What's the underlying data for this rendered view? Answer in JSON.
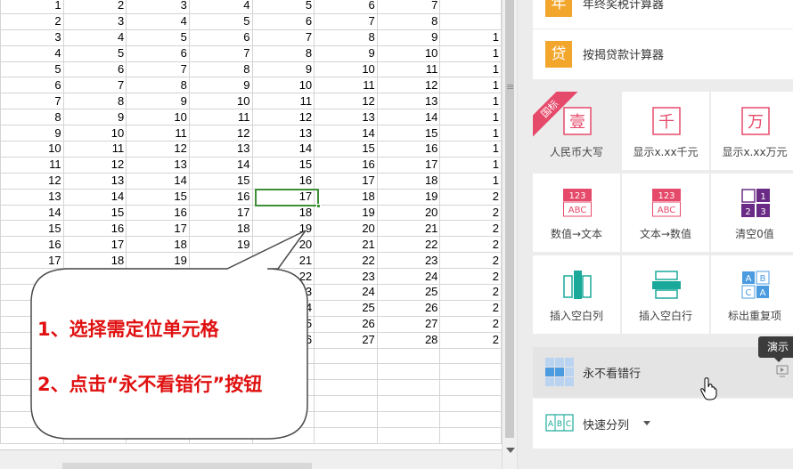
{
  "spreadsheet": {
    "rows": [
      [
        "1",
        "2",
        "3",
        "4",
        "5",
        "6",
        "7",
        ""
      ],
      [
        "2",
        "3",
        "4",
        "5",
        "6",
        "7",
        "8",
        ""
      ],
      [
        "3",
        "4",
        "5",
        "6",
        "7",
        "8",
        "9",
        "1"
      ],
      [
        "4",
        "5",
        "6",
        "7",
        "8",
        "9",
        "10",
        "1"
      ],
      [
        "5",
        "6",
        "7",
        "8",
        "9",
        "10",
        "11",
        "1"
      ],
      [
        "6",
        "7",
        "8",
        "9",
        "10",
        "11",
        "12",
        "1"
      ],
      [
        "7",
        "8",
        "9",
        "10",
        "11",
        "12",
        "13",
        "1"
      ],
      [
        "8",
        "9",
        "10",
        "11",
        "12",
        "13",
        "14",
        "1"
      ],
      [
        "9",
        "10",
        "11",
        "12",
        "13",
        "14",
        "15",
        "1"
      ],
      [
        "10",
        "11",
        "12",
        "13",
        "14",
        "15",
        "16",
        "1"
      ],
      [
        "11",
        "12",
        "13",
        "14",
        "15",
        "16",
        "17",
        "1"
      ],
      [
        "12",
        "13",
        "14",
        "15",
        "16",
        "17",
        "18",
        "1"
      ],
      [
        "13",
        "14",
        "15",
        "16",
        "17",
        "18",
        "19",
        "2"
      ],
      [
        "14",
        "15",
        "16",
        "17",
        "18",
        "19",
        "20",
        "2"
      ],
      [
        "15",
        "16",
        "17",
        "18",
        "19",
        "20",
        "21",
        "2"
      ],
      [
        "16",
        "17",
        "18",
        "19",
        "20",
        "21",
        "22",
        "2"
      ],
      [
        "17",
        "18",
        "19",
        "",
        "21",
        "22",
        "23",
        "2"
      ],
      [
        "",
        "",
        "",
        "",
        "22",
        "23",
        "24",
        "2"
      ],
      [
        "",
        "",
        "",
        "",
        "23",
        "24",
        "25",
        "2"
      ],
      [
        "",
        "",
        "",
        "",
        "24",
        "25",
        "26",
        "2"
      ],
      [
        "",
        "",
        "",
        "",
        "25",
        "26",
        "27",
        "2"
      ],
      [
        "",
        "",
        "",
        "",
        "26",
        "27",
        "28",
        "2"
      ],
      [
        "",
        "",
        "",
        "",
        "",
        "",
        "",
        ""
      ],
      [
        "",
        "",
        "",
        "",
        "",
        "",
        "",
        ""
      ],
      [
        "",
        "",
        "",
        "",
        "",
        "",
        "",
        ""
      ],
      [
        "",
        "",
        "",
        "",
        "",
        "",
        "",
        ""
      ],
      [
        "",
        "",
        "",
        "",
        "",
        "",
        "",
        ""
      ],
      [
        "",
        "",
        "",
        "",
        "",
        "",
        "",
        ""
      ]
    ]
  },
  "callout": {
    "line1": "1、选择需定位单元格",
    "line2": "2、点击“永不看错行”按钮"
  },
  "panel": {
    "top_items": [
      {
        "icon": "年",
        "label": "年终奖税计算器"
      },
      {
        "icon": "贷",
        "label": "按揭贷款计算器"
      }
    ],
    "ribbon": "国标",
    "tiles": [
      {
        "label": "人民币大写",
        "icon": "壹",
        "icon_name": "rmb-uppercase-icon"
      },
      {
        "label": "显示x.xx千元",
        "icon": "千",
        "icon_name": "thousand-icon"
      },
      {
        "label": "显示x.xx万元",
        "icon": "万",
        "icon_name": "ten-thousand-icon"
      },
      {
        "label": "数值→文本",
        "icon_top": "123",
        "icon_bottom": "ABC",
        "icon_name": "number-to-text-icon"
      },
      {
        "label": "文本→数值",
        "icon_top": "123",
        "icon_bottom": "ABC",
        "icon_name": "text-to-number-icon"
      },
      {
        "label": "清空0值",
        "icon_cells": [
          "",
          "1",
          "2",
          "3"
        ],
        "icon_name": "clear-zero-icon"
      },
      {
        "label": "插入空白列",
        "icon_name": "insert-blank-column-icon"
      },
      {
        "label": "插入空白行",
        "icon_name": "insert-blank-row-icon"
      },
      {
        "label": "标出重复项",
        "icon_cells": [
          "A",
          "B",
          "C",
          "A"
        ],
        "icon_name": "mark-duplicates-icon"
      }
    ],
    "bottom_items": [
      {
        "label": "永不看错行",
        "icon_name": "never-misread-row-icon"
      },
      {
        "label": "快速分列",
        "icon_cells": [
          "A",
          "B",
          "C"
        ],
        "icon_name": "quick-split-column-icon"
      }
    ],
    "tooltip": "演示"
  },
  "colors": {
    "orange": "#f2a62b",
    "pink": "#e64a6a",
    "teal": "#1aa89a",
    "purple": "#6a2b86",
    "blue": "#4a9be0",
    "callout_red": "#e01010",
    "selection_green": "#3f8f37"
  }
}
